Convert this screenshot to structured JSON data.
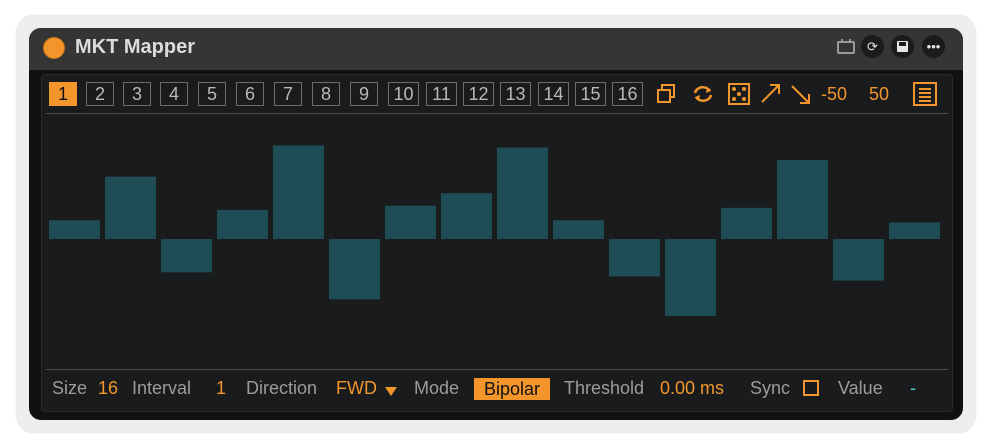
{
  "window": {
    "title": "MKT Mapper"
  },
  "toolbar": {
    "steps": [
      "1",
      "2",
      "3",
      "4",
      "5",
      "6",
      "7",
      "8",
      "9",
      "10",
      "11",
      "12",
      "13",
      "14",
      "15",
      "16"
    ],
    "active_step": 0,
    "range_min": "-50",
    "range_max": "50"
  },
  "icons": {
    "title": [
      "monitor-icon",
      "refresh-icon",
      "save-icon",
      "more-icon"
    ],
    "tools": [
      "copy-icon",
      "swap-icon",
      "dice-icon",
      "ramp-up-icon",
      "ramp-down-icon",
      "list-icon"
    ]
  },
  "chart_data": {
    "type": "bar",
    "categories": [
      "1",
      "2",
      "3",
      "4",
      "5",
      "6",
      "7",
      "8",
      "9",
      "10",
      "11",
      "12",
      "13",
      "14",
      "15",
      "16"
    ],
    "values": [
      9,
      30,
      -16,
      14,
      45,
      -29,
      16,
      22,
      44,
      9,
      -18,
      -37,
      15,
      38,
      -20,
      8
    ],
    "ylim": [
      -50,
      50
    ],
    "color": "#1f4d55"
  },
  "bottom": {
    "size_label": "Size",
    "size_value": "16",
    "interval_label": "Interval",
    "interval_value": "1",
    "direction_label": "Direction",
    "direction_value": "FWD",
    "mode_label": "Mode",
    "mode_value": "Bipolar",
    "threshold_label": "Threshold",
    "threshold_value": "0.00 ms",
    "sync_label": "Sync",
    "value_label": "Value",
    "value_value": "-"
  },
  "colors": {
    "accent": "#f2962c",
    "bar": "#1f4d55",
    "background": "#1a1b1d"
  }
}
